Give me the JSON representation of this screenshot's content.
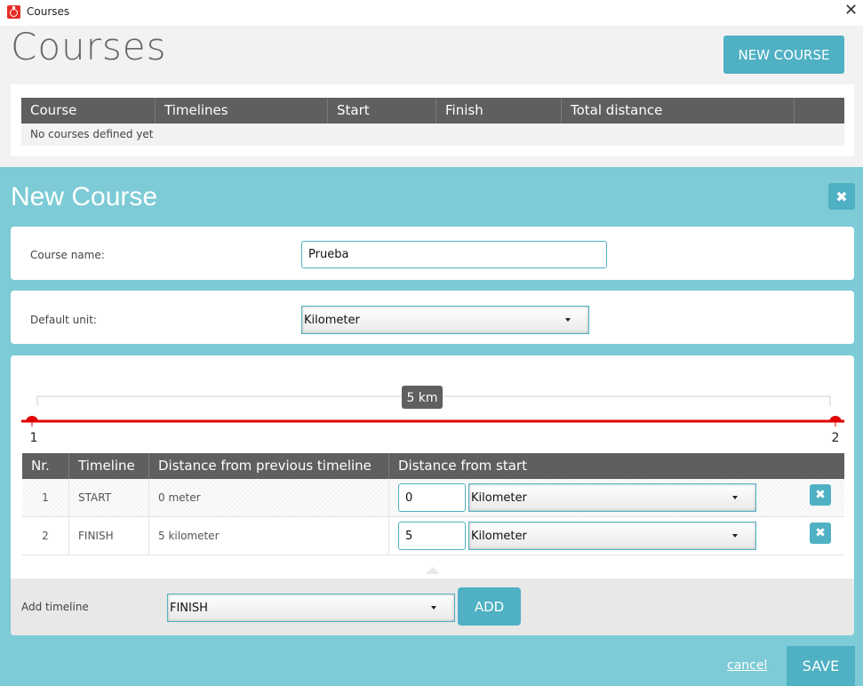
{
  "window": {
    "title": "Courses",
    "icon": "stopwatch-icon",
    "close_glyph": "✕"
  },
  "page": {
    "title": "Courses",
    "new_course_label": "NEW COURSE"
  },
  "courses_table": {
    "columns": [
      "Course",
      "Timelines",
      "Start",
      "Finish",
      "Total distance"
    ],
    "empty_message": "No courses defined yet"
  },
  "new_course": {
    "title": "New Course",
    "course_name_label": "Course name:",
    "course_name_value": "Prueba",
    "default_unit_label": "Default unit:",
    "default_unit_value": "Kilometer",
    "distance_badge": "5 km",
    "track_start_label": "1",
    "track_end_label": "2",
    "timelines_table": {
      "columns": [
        "Nr.",
        "Timeline",
        "Distance from previous timeline",
        "Distance from start"
      ],
      "rows": [
        {
          "nr": "1",
          "timeline": "START",
          "from_previous": "0 meter",
          "from_start": "0",
          "unit": "Kilometer"
        },
        {
          "nr": "2",
          "timeline": "FINISH",
          "from_previous": "5 kilometer",
          "from_start": "5",
          "unit": "Kilometer"
        }
      ]
    },
    "add_timeline_label": "Add timeline",
    "add_timeline_value": "FINISH",
    "add_label": "ADD",
    "cancel_label": "cancel",
    "save_label": "SAVE"
  },
  "colors": {
    "accent": "#4fb1c3",
    "panel": "#7ccbd6",
    "header": "#5f5f5f",
    "track": "#e00000"
  }
}
